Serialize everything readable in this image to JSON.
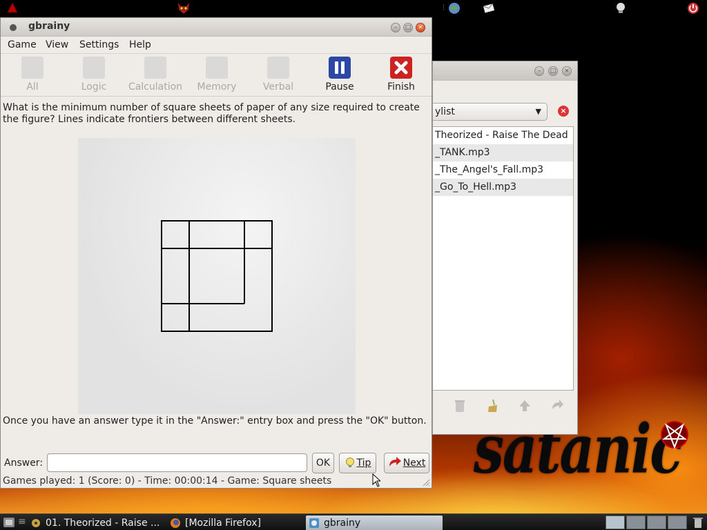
{
  "taskbar": {
    "tasks": [
      {
        "label": "01. Theorized - Raise ..."
      },
      {
        "label": "[Mozilla Firefox]"
      },
      {
        "label": "gbrainy"
      }
    ]
  },
  "music_window": {
    "playlist_label": "ylist",
    "tracks": [
      "Theorized - Raise The Dead",
      "_TANK.mp3",
      "_The_Angel's_Fall.mp3",
      "_Go_To_Hell.mp3"
    ],
    "icons": [
      "delete-icon",
      "broom-icon",
      "up-arrow-icon",
      "redo-icon"
    ]
  },
  "wallpaper": {
    "logo_text": "satanic"
  },
  "gbrainy": {
    "title": "gbrainy",
    "menu": [
      "Game",
      "View",
      "Settings",
      "Help"
    ],
    "toolbar": {
      "all": "All",
      "logic": "Logic",
      "calculation": "Calculation",
      "memory": "Memory",
      "verbal": "Verbal",
      "pause": "Pause",
      "finish": "Finish"
    },
    "question": "What is the minimum number of square sheets of paper of any size required to create the figure? Lines indicate frontiers between different sheets.",
    "instructions": "Once you have an answer type it in the \"Answer:\" entry box and press the \"OK\" button.",
    "answer_label": "Answer:",
    "answer_value": "",
    "ok_label": "OK",
    "tip_label": "Tip",
    "next_label": "Next",
    "status": "Games played: 1 (Score: 0) - Time: 00:00:14 - Game: Square sheets"
  },
  "colors": {
    "pause_blue": "#2b48a8",
    "finish_red": "#cc2222",
    "window_bg": "#efebe7"
  }
}
